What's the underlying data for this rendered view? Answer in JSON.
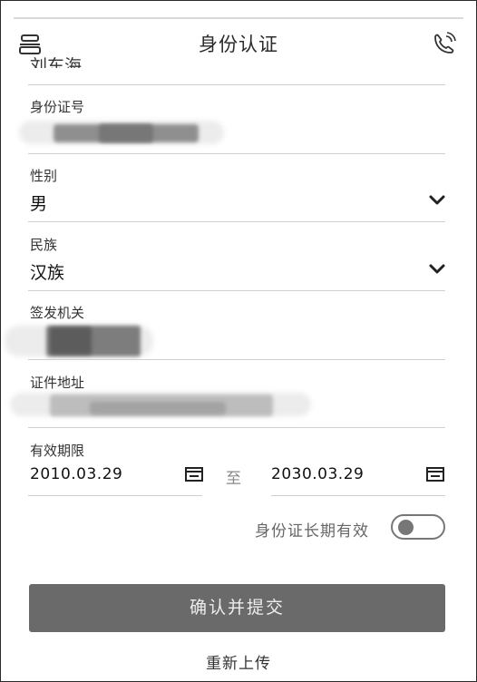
{
  "header": {
    "title": "身份认证",
    "left_icon": "layers-icon",
    "right_icon": "phone-call-icon"
  },
  "form": {
    "name_value_partial": "刘东海",
    "id_number": {
      "label": "身份证号",
      "value": ""
    },
    "gender": {
      "label": "性别",
      "value": "男"
    },
    "ethnicity": {
      "label": "民族",
      "value": "汉族"
    },
    "issuing_authority": {
      "label": "签发机关",
      "value": ""
    },
    "address": {
      "label": "证件地址",
      "value": ""
    },
    "validity": {
      "label": "有效期限",
      "start": "2010.03.29",
      "separator": "至",
      "end": "2030.03.29"
    },
    "long_term": {
      "label": "身份证长期有效",
      "enabled": false
    }
  },
  "actions": {
    "submit_label": "确认并提交",
    "reupload_label": "重新上传"
  },
  "colors": {
    "button_bg": "#6a6a6a",
    "divider": "#cfcfcf",
    "text": "#1a1a1a"
  }
}
